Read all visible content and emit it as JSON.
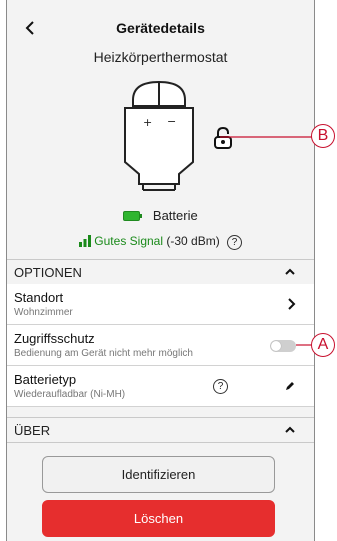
{
  "header": {
    "title": "Gerätedetails",
    "subtitle": "Heizkörperthermostat"
  },
  "device": {
    "illustration": "thermostat-head-icon",
    "plus": "+",
    "minus": "−"
  },
  "status": {
    "battery_label": "Batterie",
    "signal_label": "Gutes Signal",
    "signal_value": "(-30 dBm)",
    "help": "?"
  },
  "sections": {
    "options": {
      "label": "OPTIONEN"
    },
    "about": {
      "label": "ÜBER"
    }
  },
  "rows": {
    "location": {
      "title": "Standort",
      "subtitle": "Wohnzimmer"
    },
    "access": {
      "title": "Zugriffsschutz",
      "subtitle": "Bedienung am Gerät nicht mehr möglich",
      "enabled": false
    },
    "battery_type": {
      "title": "Batterietyp",
      "subtitle": "Wiederaufladbar (Ni-MH)",
      "help": "?"
    }
  },
  "buttons": {
    "identify": "Identifizieren",
    "delete": "Löschen"
  },
  "callouts": {
    "a": "A",
    "b": "B"
  },
  "colors": {
    "signal_green": "#1a8a1a",
    "battery_green": "#2fb52f",
    "delete_red": "#e62e2e",
    "callout_red": "#c8102e"
  }
}
